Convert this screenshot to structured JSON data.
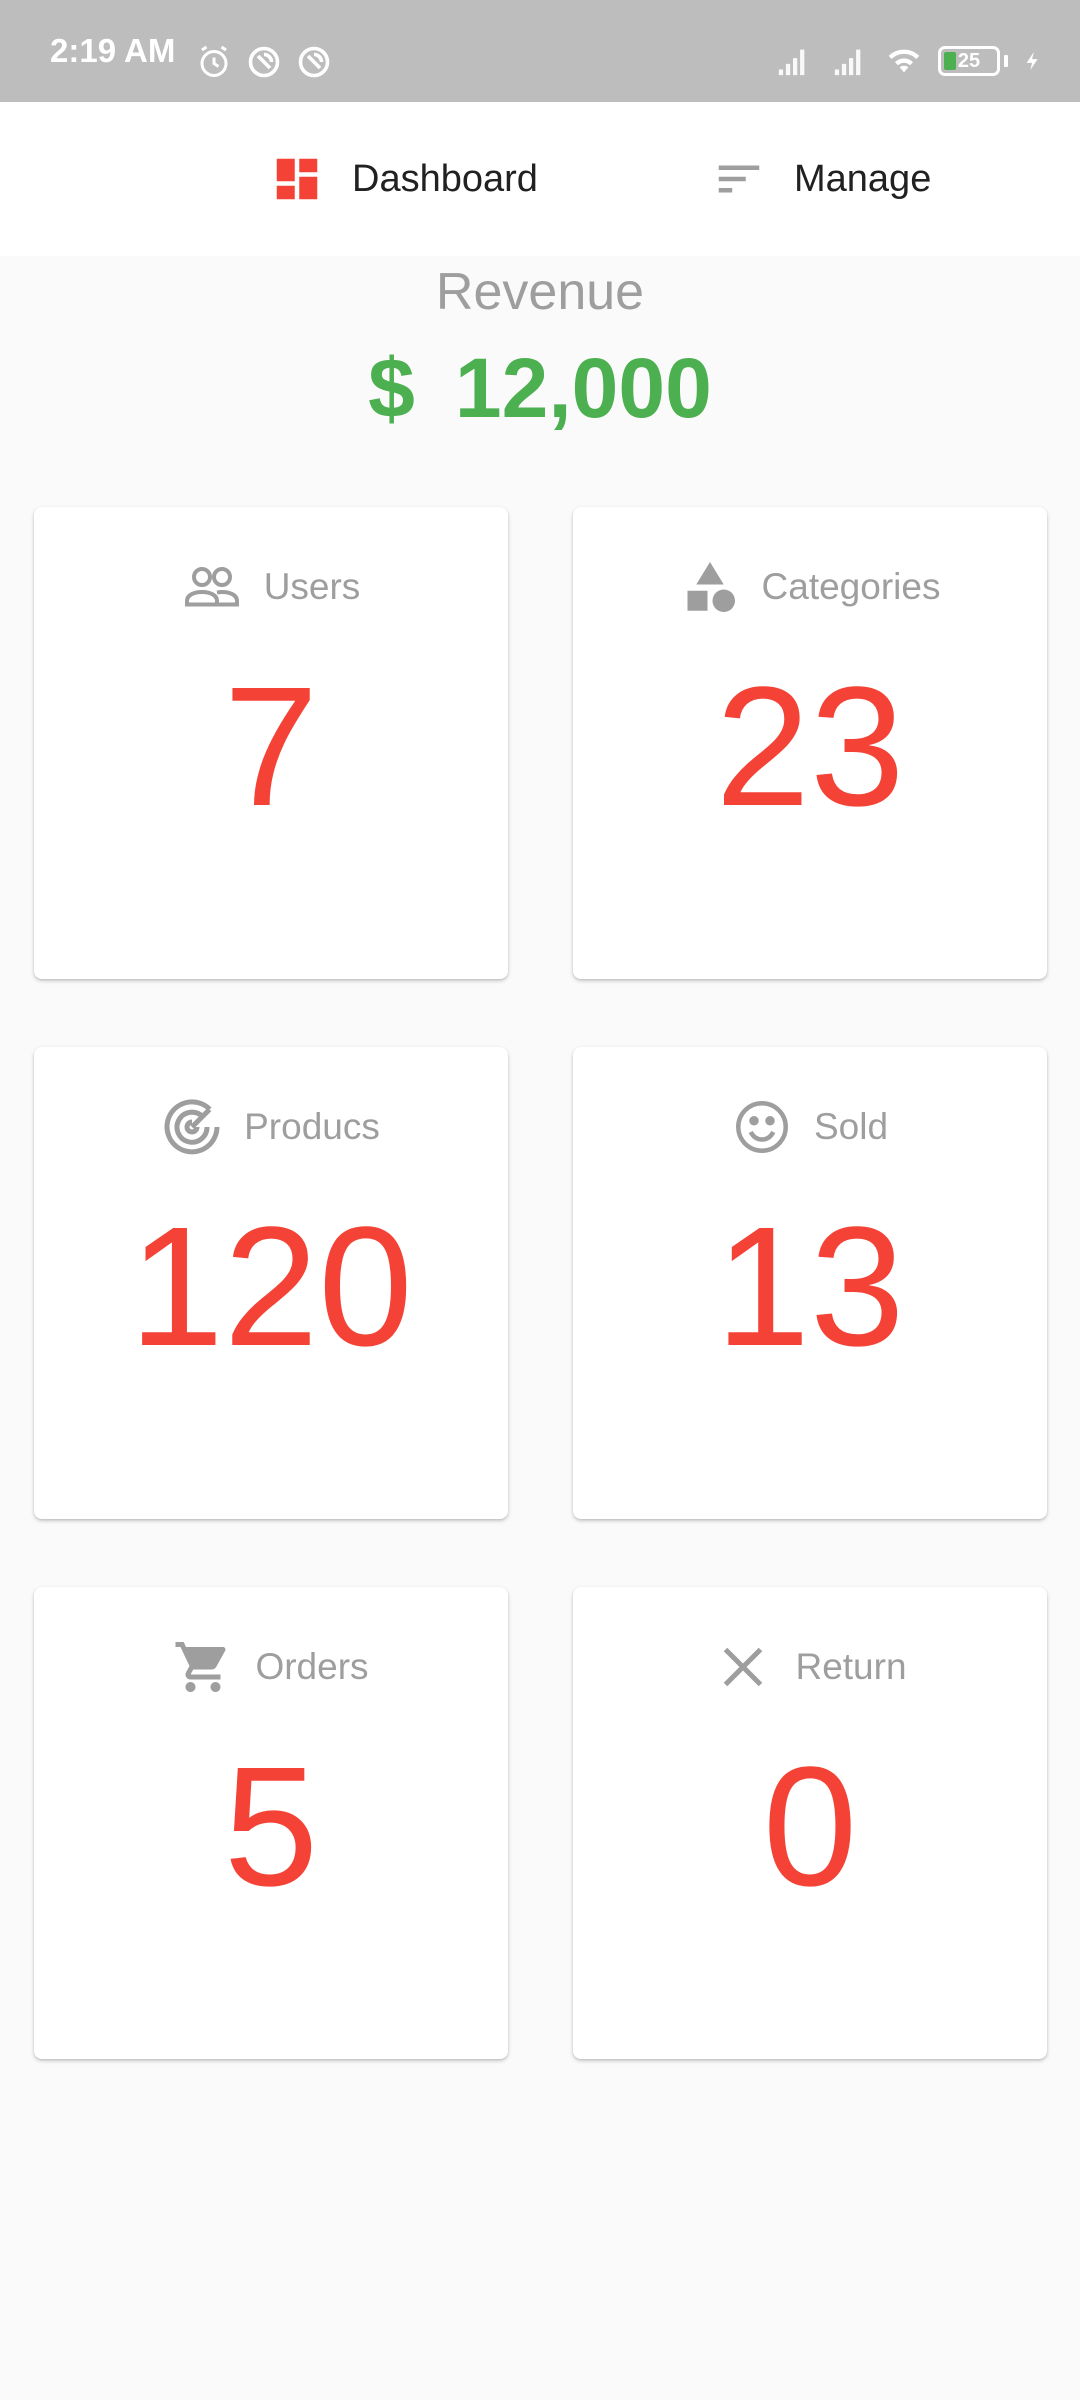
{
  "status_bar": {
    "time": "2:19 AM",
    "icons": [
      "alarm-icon",
      "sync-icon",
      "sync-icon",
      "signal-icon",
      "signal-icon",
      "wifi-icon",
      "battery-icon",
      "charging-icon"
    ],
    "battery": "25",
    "battery_color": "#4caf50"
  },
  "nav": {
    "dashboard_label": "Dashboard",
    "manage_label": "Manage",
    "dashboard_icon": "dashboard-icon",
    "manage_icon": "sort-icon"
  },
  "revenue": {
    "title": "Revenue",
    "currency": "$",
    "amount": "12,000",
    "color": "#4caf50"
  },
  "cards": [
    {
      "label": "Users",
      "value": "7",
      "icon": "people-icon"
    },
    {
      "label": "Categories",
      "value": "23",
      "icon": "category-icon"
    },
    {
      "label": "Producs",
      "value": "120",
      "icon": "track-changes-icon"
    },
    {
      "label": "Sold",
      "value": "13",
      "icon": "smiley-icon"
    },
    {
      "label": "Orders",
      "value": "5",
      "icon": "cart-icon"
    },
    {
      "label": "Return",
      "value": "0",
      "icon": "close-icon"
    }
  ],
  "colors": {
    "accent": "#f44336",
    "label": "#9e9e9e",
    "status_bar": "#bdbdbd"
  }
}
